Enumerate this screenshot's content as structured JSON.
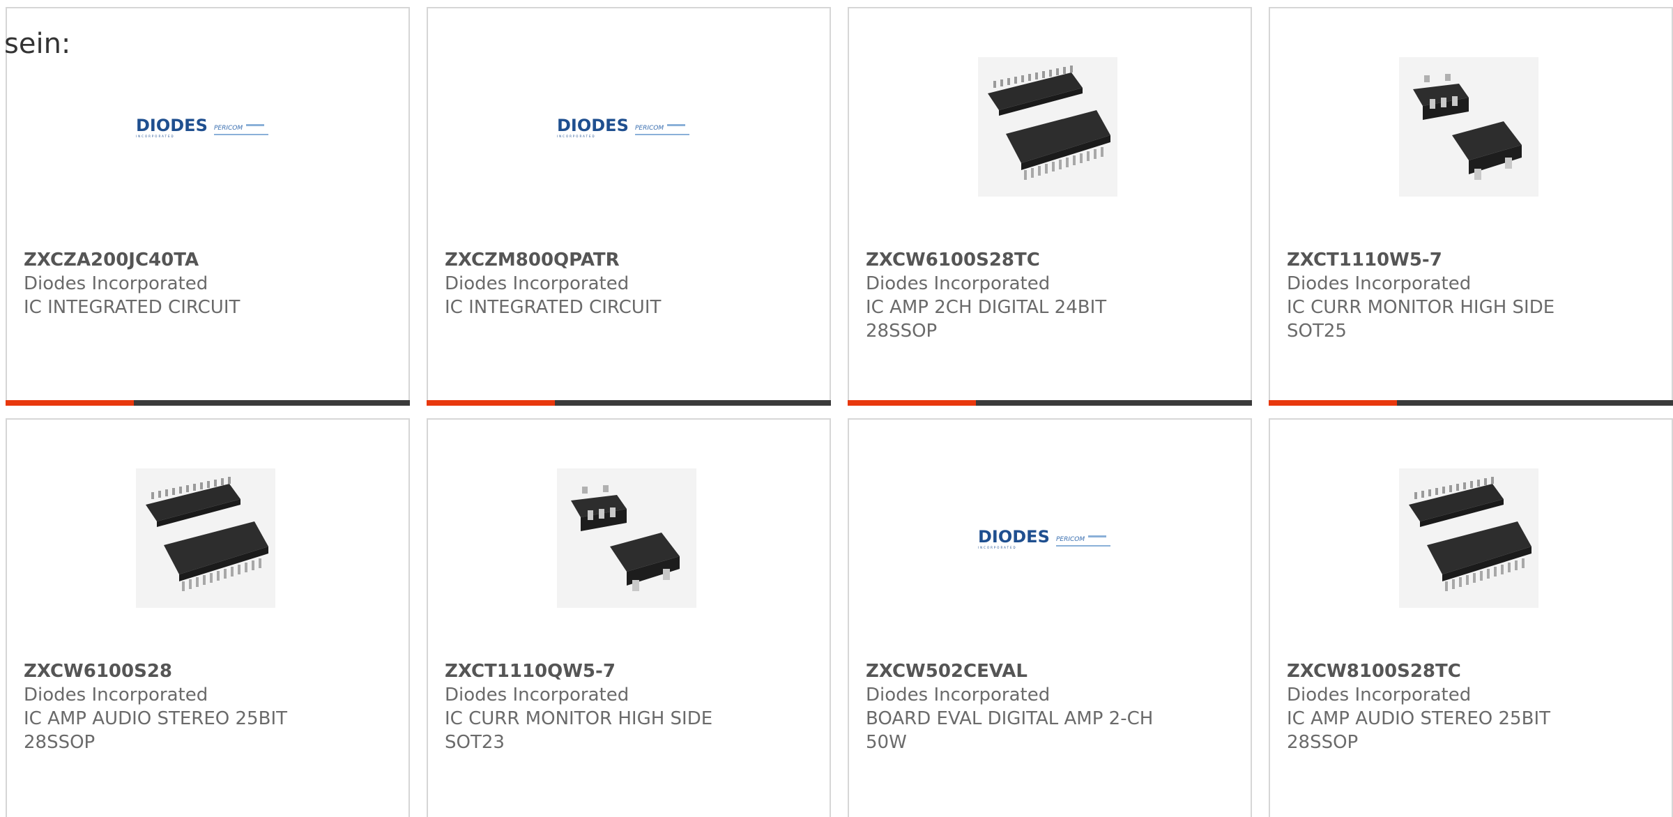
{
  "intro_text": "sein:",
  "colors": {
    "accent": "#e8380d",
    "bar": "#3a3a3a",
    "brand_blue": "#1f4f8f"
  },
  "cards": [
    {
      "part": "ZXCZA200JC40TA",
      "maker": "Diodes Incorporated",
      "desc1": "IC INTEGRATED CIRCUIT",
      "desc2": "",
      "image": "diodes-logo",
      "logo": "DIODES",
      "logo2": "PERICOM"
    },
    {
      "part": "ZXCZM800QPATR",
      "maker": "Diodes Incorporated",
      "desc1": "IC INTEGRATED CIRCUIT",
      "desc2": "",
      "image": "diodes-logo",
      "logo": "DIODES",
      "logo2": "PERICOM"
    },
    {
      "part": "ZXCW6100S28TC",
      "maker": "Diodes Incorporated",
      "desc1": "IC AMP 2CH DIGITAL 24BIT",
      "desc2": "28SSOP",
      "image": "ssop-chip"
    },
    {
      "part": "ZXCT1110W5-7",
      "maker": "Diodes Incorporated",
      "desc1": "IC CURR MONITOR HIGH SIDE",
      "desc2": "SOT25",
      "image": "sot-chip"
    },
    {
      "part": "ZXCW6100S28",
      "maker": "Diodes Incorporated",
      "desc1": "IC AMP AUDIO STEREO 25BIT",
      "desc2": "28SSOP",
      "image": "ssop-chip"
    },
    {
      "part": "ZXCT1110QW5-7",
      "maker": "Diodes Incorporated",
      "desc1": "IC CURR MONITOR HIGH SIDE",
      "desc2": "SOT23",
      "image": "sot-chip"
    },
    {
      "part": "ZXCW502CEVAL",
      "maker": "Diodes Incorporated",
      "desc1": "BOARD EVAL DIGITAL AMP 2-CH",
      "desc2": "50W",
      "image": "diodes-logo",
      "logo": "DIODES",
      "logo2": "PERICOM"
    },
    {
      "part": "ZXCW8100S28TC",
      "maker": "Diodes Incorporated",
      "desc1": "IC AMP AUDIO STEREO 25BIT",
      "desc2": "28SSOP",
      "image": "ssop-chip"
    }
  ]
}
